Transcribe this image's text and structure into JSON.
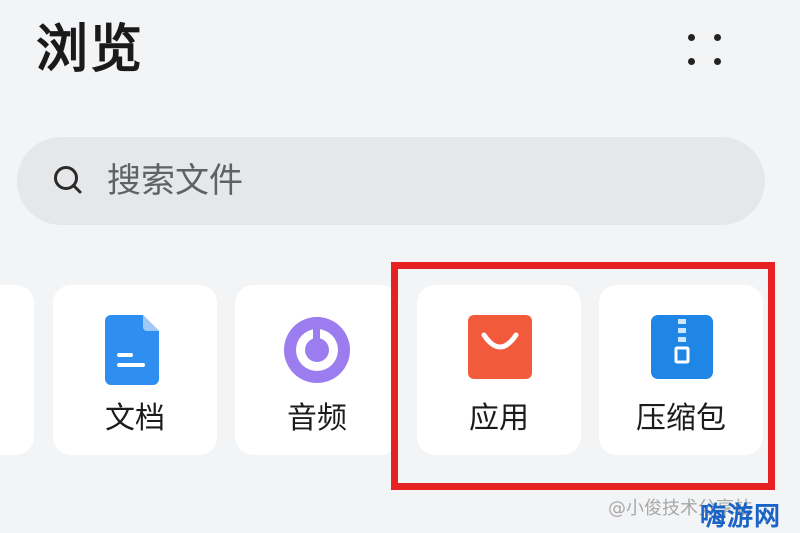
{
  "header": {
    "title": "浏览"
  },
  "search": {
    "placeholder": "搜索文件"
  },
  "categories": [
    {
      "label": "文档",
      "icon": "document-icon"
    },
    {
      "label": "音频",
      "icon": "audio-icon"
    },
    {
      "label": "应用",
      "icon": "app-store-icon"
    },
    {
      "label": "压缩包",
      "icon": "zip-archive-icon"
    }
  ],
  "colors": {
    "highlight": "#e62121",
    "document": "#2e8ff0",
    "audio": "#9b7df0",
    "app": "#f25a3c",
    "zip": "#1f86e6"
  },
  "watermark": {
    "text": "@小俊技术分享站",
    "logo": "嗨游网"
  }
}
